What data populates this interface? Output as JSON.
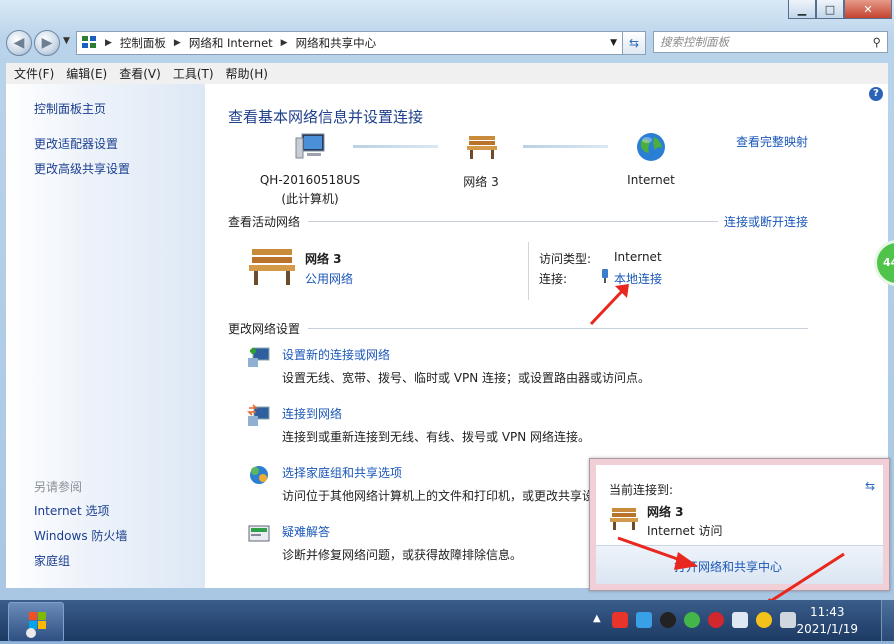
{
  "window": {
    "controls": {
      "minimize": "▁",
      "maximize": "□",
      "close": "✕"
    }
  },
  "address_bar": {
    "breadcrumbs": [
      "控制面板",
      "网络和 Internet",
      "网络和共享中心"
    ],
    "search_placeholder": "搜索控制面板"
  },
  "menu": [
    "文件(F)",
    "编辑(E)",
    "查看(V)",
    "工具(T)",
    "帮助(H)"
  ],
  "sidebar": {
    "items": [
      "控制面板主页",
      "更改适配器设置",
      "更改高级共享设置"
    ],
    "see_also_header": "另请参阅",
    "see_also": [
      "Internet 选项",
      "Windows 防火墙",
      "家庭组"
    ]
  },
  "main": {
    "title": "查看基本网络信息并设置连接",
    "full_map_link": "查看完整映射",
    "map": {
      "computer_name": "QH-20160518US",
      "computer_sub": "(此计算机)",
      "network_name": "网络  3",
      "internet": "Internet"
    },
    "active_header": "查看活动网络",
    "connect_disconnect_link": "连接或断开连接",
    "active_network": {
      "name": "网络  3",
      "type_link": "公用网络",
      "access_label": "访问类型:",
      "access_value": "Internet",
      "conn_label": "连接:",
      "conn_link": "本地连接"
    },
    "change_header": "更改网络设置",
    "tasks": [
      {
        "title": "设置新的连接或网络",
        "desc": "设置无线、宽带、拨号、临时或 VPN 连接；或设置路由器或访问点。"
      },
      {
        "title": "连接到网络",
        "desc": "连接到或重新连接到无线、有线、拨号或 VPN 网络连接。"
      },
      {
        "title": "选择家庭组和共享选项",
        "desc": "访问位于其他网络计算机上的文件和打印机，或更改共享设"
      },
      {
        "title": "疑难解答",
        "desc": "诊断并修复网络问题，或获得故障排除信息。"
      }
    ]
  },
  "popup": {
    "header": "当前连接到:",
    "network": "网络  3",
    "access": "Internet 访问",
    "open_link": "打开网络和共享中心"
  },
  "taskbar": {
    "time": "11:43",
    "date": "2021/1/19",
    "edge_badge": "44"
  },
  "colors": {
    "link": "#1a57b8",
    "title": "#1e3f8a",
    "arrow": "#e8281f"
  }
}
